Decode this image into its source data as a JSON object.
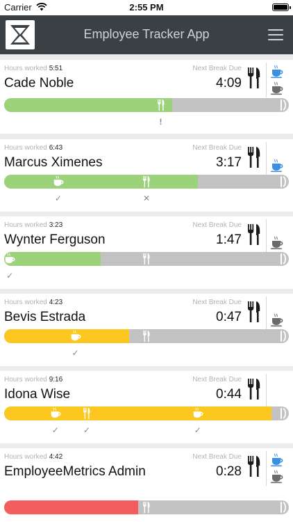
{
  "status_bar": {
    "carrier": "Carrier",
    "time": "2:55 PM"
  },
  "header": {
    "title": "Employee Tracker App"
  },
  "labels": {
    "hours_worked": "Hours worked",
    "next_break_due": "Next Break Due"
  },
  "colors": {
    "green": "#9bd27a",
    "yellow": "#fcc71e",
    "red": "#f45d5d",
    "gray": "#c2c2c2",
    "cup_blue": "#3b8fe0",
    "cup_gray": "#6b6b6b"
  },
  "employees": [
    {
      "name": "Cade Noble",
      "hours": "5:51",
      "next_break": "4:09",
      "progress": 0.59,
      "bar_color": "green",
      "cups": [
        "blue",
        "gray"
      ],
      "bar_icons": [
        {
          "type": "meal",
          "pos": 0.55
        }
      ],
      "marks": [
        {
          "symbol": "!",
          "pos": 0.55
        }
      ]
    },
    {
      "name": "Marcus Ximenes",
      "hours": "6:43",
      "next_break": "3:17",
      "progress": 0.68,
      "bar_color": "green",
      "cups": [
        "blue"
      ],
      "bar_icons": [
        {
          "type": "coffee",
          "pos": 0.19
        },
        {
          "type": "meal",
          "pos": 0.5
        }
      ],
      "marks": [
        {
          "symbol": "✓",
          "pos": 0.19
        },
        {
          "symbol": "✕",
          "pos": 0.5
        }
      ]
    },
    {
      "name": "Wynter Ferguson",
      "hours": "3:23",
      "next_break": "1:47",
      "progress": 0.34,
      "bar_color": "green",
      "cups": [
        "gray"
      ],
      "bar_icons": [
        {
          "type": "coffee",
          "pos": 0.02
        },
        {
          "type": "meal",
          "pos": 0.5
        }
      ],
      "marks": [
        {
          "symbol": "✓",
          "pos": 0.02
        }
      ]
    },
    {
      "name": "Bevis Estrada",
      "hours": "4:23",
      "next_break": "0:47",
      "progress": 0.44,
      "bar_color": "yellow",
      "cups": [
        "gray"
      ],
      "bar_icons": [
        {
          "type": "coffee",
          "pos": 0.25
        },
        {
          "type": "meal",
          "pos": 0.5
        }
      ],
      "marks": [
        {
          "symbol": "✓",
          "pos": 0.25
        }
      ]
    },
    {
      "name": "Idona Wise",
      "hours": "9:16",
      "next_break": "0:44",
      "progress": 0.94,
      "bar_color": "yellow",
      "cups": [],
      "bar_icons": [
        {
          "type": "coffee",
          "pos": 0.18
        },
        {
          "type": "meal",
          "pos": 0.29
        },
        {
          "type": "coffee",
          "pos": 0.68
        }
      ],
      "marks": [
        {
          "symbol": "✓",
          "pos": 0.18
        },
        {
          "symbol": "✓",
          "pos": 0.29
        },
        {
          "symbol": "✓",
          "pos": 0.68
        }
      ]
    },
    {
      "name": "EmployeeMetrics Admin",
      "hours": "4:42",
      "next_break": "0:28",
      "progress": 0.47,
      "bar_color": "red",
      "cups": [
        "blue",
        "gray"
      ],
      "bar_icons": [
        {
          "type": "meal",
          "pos": 0.5
        }
      ],
      "marks": []
    }
  ]
}
